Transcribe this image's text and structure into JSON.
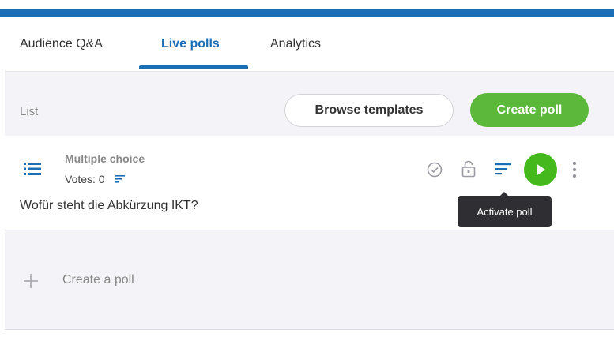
{
  "tabs": [
    {
      "label": "Audience Q&A"
    },
    {
      "label": "Live polls",
      "active": true
    },
    {
      "label": "Analytics"
    }
  ],
  "toolbar": {
    "list_label": "List",
    "browse_label": "Browse templates",
    "create_label": "Create poll"
  },
  "poll": {
    "type": "Multiple choice",
    "votes": "Votes: 0",
    "question": "Wofür steht die Abkürzung IKT?",
    "tooltip": "Activate poll"
  },
  "create_row": {
    "label": "Create a poll"
  },
  "colors": {
    "brand_blue": "#1d6fb5",
    "accent_green": "#5cb83a",
    "play_green": "#44b81c",
    "tooltip_bg": "#2f2f33"
  },
  "icons": [
    "list-icon",
    "votes-sort-icon",
    "check-circle-icon",
    "lock-icon",
    "sort-icon",
    "play-icon",
    "more-vert-icon",
    "plus-icon"
  ]
}
